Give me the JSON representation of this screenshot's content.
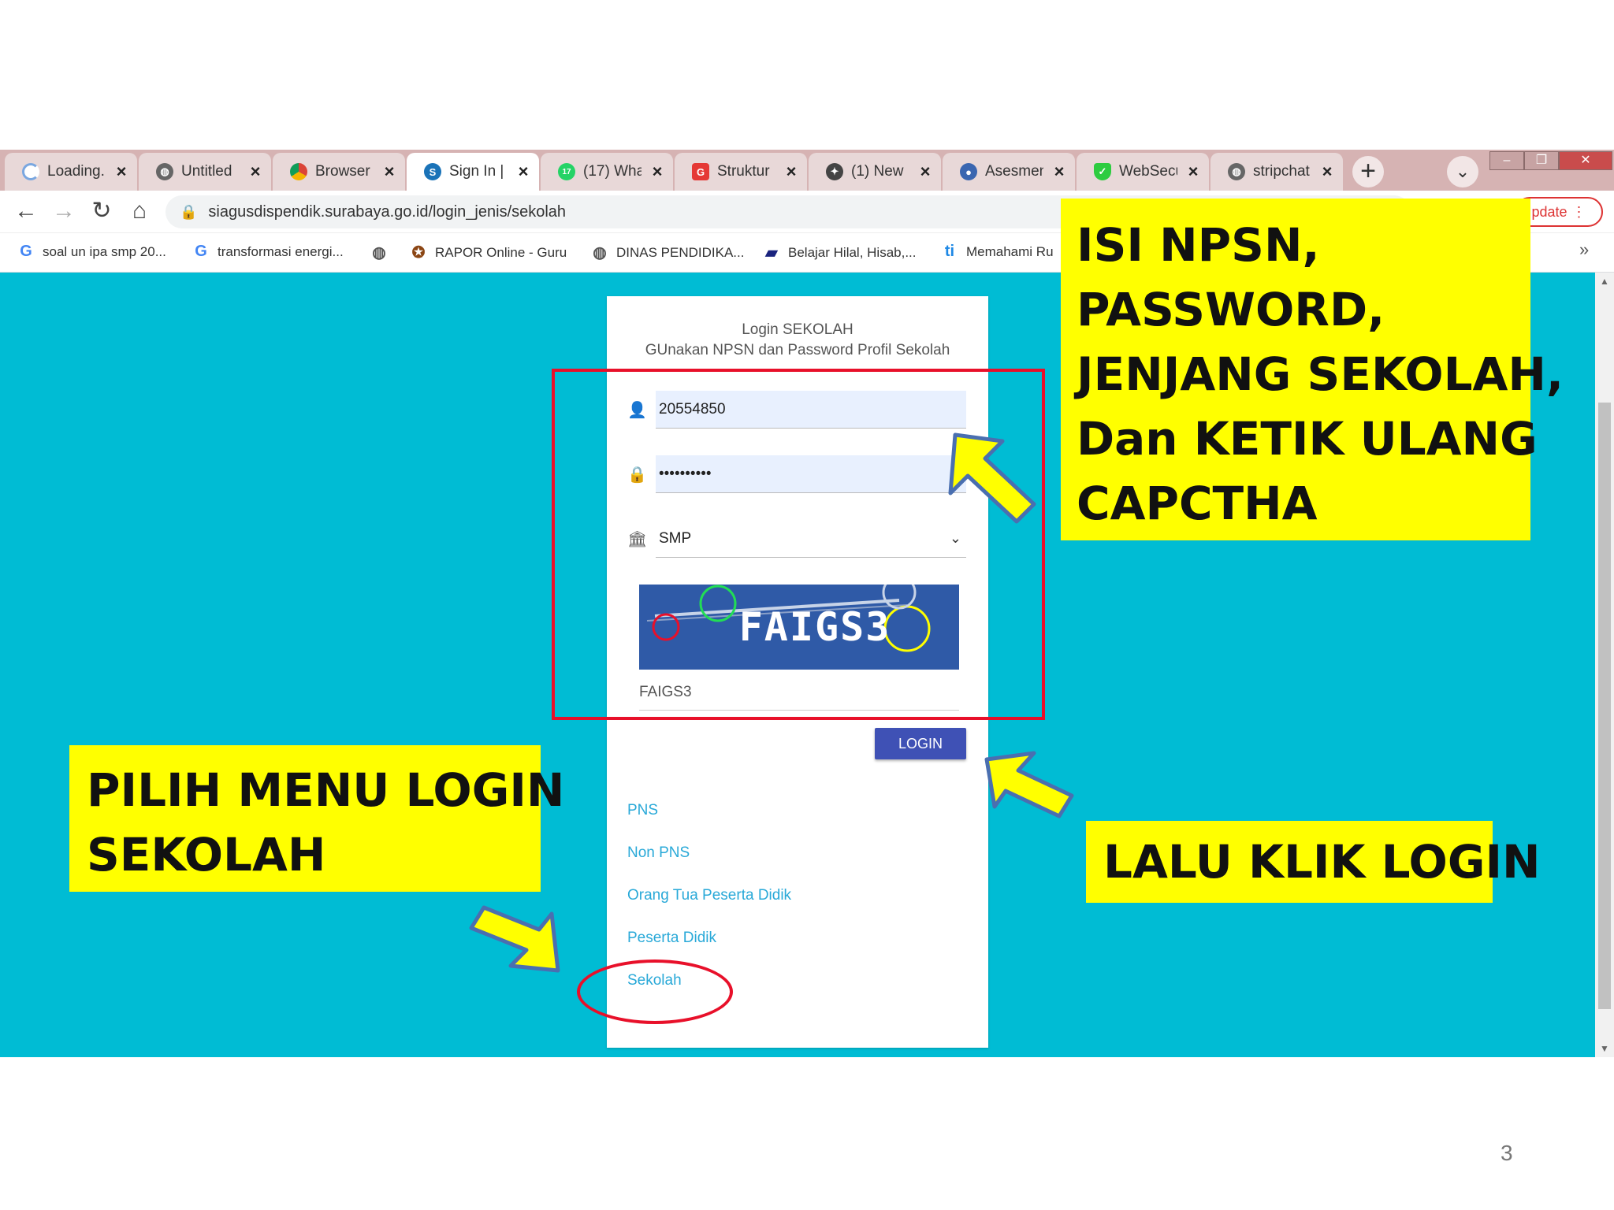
{
  "browser": {
    "tabs": [
      {
        "title": "Loading...",
        "icon": "loading-icon"
      },
      {
        "title": "Untitled",
        "icon": "globe-icon"
      },
      {
        "title": "Browser",
        "icon": "chrome-icon"
      },
      {
        "title": "Sign In |",
        "icon": "s-logo-icon"
      },
      {
        "title": "(17) Wha",
        "icon": "whatsapp-icon"
      },
      {
        "title": "Struktur",
        "icon": "google-docs-icon"
      },
      {
        "title": "(1) New",
        "icon": "bird-icon"
      },
      {
        "title": "Asesmen",
        "icon": "kemdikbud-icon"
      },
      {
        "title": "WebSecu",
        "icon": "shield-icon"
      },
      {
        "title": "stripchat",
        "icon": "globe-icon"
      }
    ],
    "active_tab": 3,
    "new_tab_symbol": "+",
    "tab_search_symbol": "⌄",
    "url": "siagusdispendik.surabaya.go.id/login_jenis/sekolah",
    "update_label": "pdate",
    "bookmarks": [
      {
        "label": "soal un ipa smp 20...",
        "icon": "google-icon"
      },
      {
        "label": "transformasi energi...",
        "icon": "google-icon"
      },
      {
        "label": "",
        "icon": "globe-icon"
      },
      {
        "label": "RAPOR Online - Guru",
        "icon": "emblem-icon"
      },
      {
        "label": "DINAS PENDIDIKA...",
        "icon": "globe-icon"
      },
      {
        "label": "Belajar Hilal, Hisab,...",
        "icon": "book-icon"
      },
      {
        "label": "Memahami Ru",
        "icon": "ti-icon"
      }
    ],
    "bookmarks_more": "»"
  },
  "login": {
    "title": "Login SEKOLAH",
    "subtitle": "GUnakan NPSN dan Password Profil Sekolah",
    "npsn_value": "20554850",
    "password_value": "••••••••••",
    "jenjang_value": "SMP",
    "captcha_image_text": "FAIGS3",
    "captcha_input_value": "FAIGS3",
    "login_button": "LOGIN",
    "menu": [
      "PNS",
      "Non PNS",
      "Orang Tua Peserta Didik",
      "Peserta Didik",
      "Sekolah"
    ]
  },
  "annotations": {
    "top_right_lines": [
      "ISI NPSN,",
      "PASSWORD,",
      "JENJANG SEKOLAH,",
      "Dan KETIK ULANG",
      "CAPCTHA"
    ],
    "left_lines": [
      "PILIH MENU LOGIN",
      "SEKOLAH"
    ],
    "right": "LALU KLIK LOGIN"
  },
  "page_number": "3",
  "colors": {
    "page_background": "#00bcd4",
    "login_button": "#3f51b5",
    "menu_link": "#29a9d8",
    "annotation_fill": "#ffff00",
    "highlight_red": "#e8102a"
  }
}
